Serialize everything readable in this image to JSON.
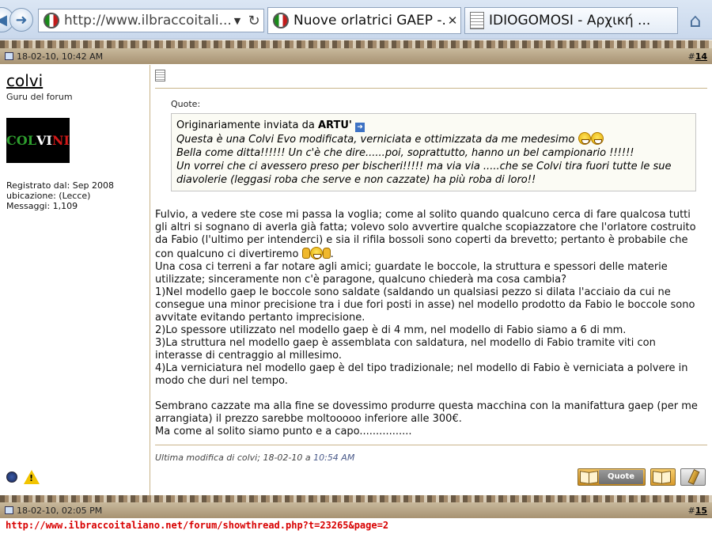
{
  "browser": {
    "address_url": "http://www.ilbraccoitali...",
    "tabs": [
      {
        "label": "Nuove orlatrici GAEP -...",
        "close": "✕"
      },
      {
        "label": "IDIOGOMOSI - Αρχική ..."
      }
    ],
    "icons": {
      "back": "back-arrow-icon",
      "forward": "forward-arrow-icon",
      "refresh": "refresh-icon",
      "home": "home-icon"
    }
  },
  "posts": [
    {
      "date": "18-02-10, 10:42 AM",
      "number_prefix": "#",
      "number": "14",
      "author": {
        "name": "colvi",
        "title": "Guru del forum",
        "avatar_text": [
          "COL",
          "VI",
          "NI"
        ],
        "avatar_colors": [
          "#2e9e2e",
          "#ffffff",
          "#d01818"
        ],
        "registered": "Registrato dal: Sep 2008",
        "location": "ubicazione: (Lecce)",
        "messages": "Messaggi: 1,109"
      },
      "quote": {
        "label": "Quote:",
        "intro": "Originariamente inviata da",
        "author": "ARTU'",
        "lines": [
          "Questa è una Colvi Evo modificata, verniciata e ottimizzata da me medesimo",
          "Bella come ditta!!!!!! Un c'è che dire......poi, soprattutto, hanno un bel campionario !!!!!!",
          "Un vorrei che ci avessero preso per bischeri!!!!! ma via via .....che se Colvi tira fuori tutte le sue diavolerie (leggasi roba che serve e non cazzate) ha più roba di loro!!"
        ]
      },
      "message": {
        "p1": "Fulvio, a vedere ste cose mi passa la voglia; come al solito quando qualcuno cerca di fare qualcosa tutti gli altri si sognano di averla già fatta; volevo solo avvertire qualche scopiazzatore che l'orlatore costruito da Fabio (l'ultimo per intenderci) e sia il rifila bossoli sono coperti da brevetto; pertanto è probabile che con qualcuno ci divertiremo",
        "p1_end": ".",
        "p2": "Una cosa ci terreni a far notare agli amici; guardate le boccole, la struttura e spessori delle materie utilizzate; sinceramente non c'è paragone, qualcuno chiederà ma cosa cambia?",
        "p3": "1)Nel modello gaep le boccole sono saldate (saldando un qualsiasi pezzo si dilata l'acciaio da cui ne consegue una minor precisione tra i due fori posti in asse) nel modello prodotto da Fabio le boccole sono avvitate evitando pertanto imprecisione.",
        "p4": "2)Lo spessore utilizzato nel modello gaep è di 4 mm, nel modello di Fabio siamo a 6 di mm.",
        "p5": "3)La struttura nel modello gaep è assemblata con saldatura, nel modello di Fabio tramite viti con interasse di centraggio al millesimo.",
        "p6": "4)La verniciatura nel modello gaep è del tipo tradizionale; nel modello di Fabio è verniciata a polvere in modo che duri nel tempo.",
        "p7": "Sembrano cazzate ma alla fine se dovessimo produrre questa macchina con la manifattura gaep (per me arrangiata) il prezzo sarebbe moltooooo inferiore alle 300€.",
        "p8": "Ma come al solito siamo punto e a capo................"
      },
      "edit_note": {
        "text": "Ultima modifica di colvi; 18-02-10 a",
        "time": "10:54 AM"
      },
      "buttons": {
        "quote": "Quote"
      }
    },
    {
      "date": "18-02-10, 02:05 PM",
      "number_prefix": "#",
      "number": "15"
    }
  ],
  "status_bar_url": "http://www.ilbraccoitaliano.net/forum/showthread.php?t=23265&page=2"
}
